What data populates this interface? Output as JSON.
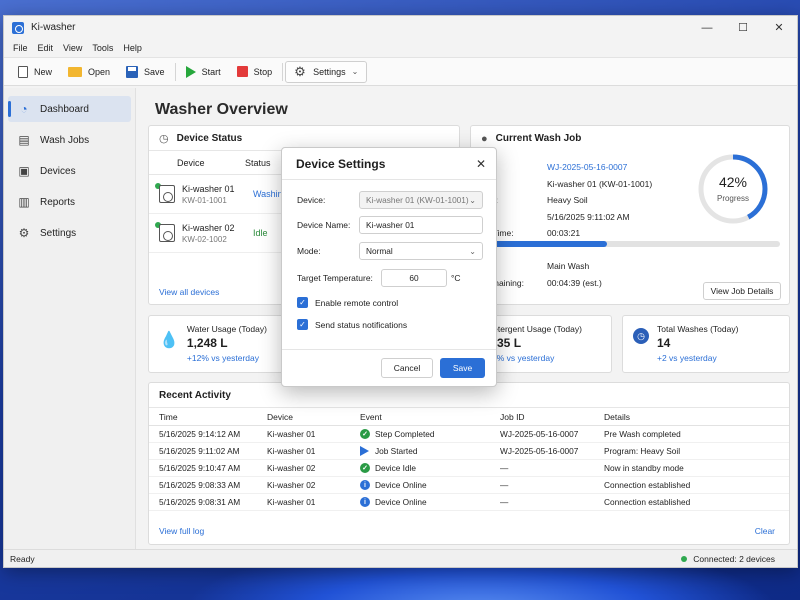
{
  "window": {
    "title": "Ki-washer",
    "minimize": "—",
    "maximize": "☐",
    "close": "✕"
  },
  "menu": [
    "File",
    "Edit",
    "View",
    "Tools",
    "Help"
  ],
  "toolbar": {
    "new": "New",
    "open": "Open",
    "save": "Save",
    "start": "Start",
    "stop": "Stop",
    "settings": "Settings"
  },
  "sidebar": {
    "items": [
      {
        "label": "Dashboard",
        "icon": "dashboard-icon",
        "active": true
      },
      {
        "label": "Wash Jobs",
        "icon": "clipboard-icon"
      },
      {
        "label": "Devices",
        "icon": "washer-icon"
      },
      {
        "label": "Reports",
        "icon": "bar-chart-icon"
      },
      {
        "label": "Settings",
        "icon": "gear-icon"
      }
    ]
  },
  "page": {
    "title": "Washer Overview"
  },
  "device_status": {
    "title": "Device Status",
    "col_device": "Device",
    "col_status": "Status",
    "devices": [
      {
        "name": "Ki-washer 01",
        "id": "KW-01-1001",
        "status": "Washing"
      },
      {
        "name": "Ki-washer 02",
        "id": "KW-02-1002",
        "status": "Idle"
      }
    ],
    "view_all": "View all devices"
  },
  "current_job": {
    "title": "Current Wash Job",
    "job_id_label": "D:",
    "job_id": "WJ-2025-05-16-0007",
    "device_label": "ce:",
    "device": "Ki-washer 01 (KW-01-1001)",
    "program_label": "ram:",
    "program": "Heavy Soil",
    "started_label": "ed:",
    "started": "5/16/2025 9:11:02 AM",
    "elapsed_label": "ed Time:",
    "elapsed": "00:03:21",
    "phase": "Main Wash",
    "remaining_label": "Remaining:",
    "remaining": "00:04:39 (est.)",
    "progress_pct": "42%",
    "progress_label": "Progress",
    "progress_value": 0.42,
    "details_button": "View Job Details"
  },
  "summary": {
    "water": {
      "label": "Water Usage (Today)",
      "value": "1,248 L",
      "delta": "+12% vs yesterday"
    },
    "detergent": {
      "label": "Detergent Usage (Today)",
      "value": "2.35 L",
      "delta": "+8% vs yesterday"
    },
    "washes": {
      "label": "Total Washes (Today)",
      "value": "14",
      "delta": "+2 vs yesterday"
    }
  },
  "activity": {
    "title": "Recent Activity",
    "headers": {
      "time": "Time",
      "device": "Device",
      "event": "Event",
      "job": "Job ID",
      "details": "Details"
    },
    "rows": [
      {
        "time": "5/16/2025 9:14:12 AM",
        "device": "Ki-washer 01",
        "event": "Step Completed",
        "icon": "check",
        "job": "WJ-2025-05-16-0007",
        "details": "Pre Wash completed"
      },
      {
        "time": "5/16/2025 9:11:02 AM",
        "device": "Ki-washer 01",
        "event": "Job Started",
        "icon": "play",
        "job": "WJ-2025-05-16-0007",
        "details": "Program: Heavy Soil"
      },
      {
        "time": "5/16/2025 9:10:47 AM",
        "device": "Ki-washer 02",
        "event": "Device Idle",
        "icon": "check",
        "job": "—",
        "details": "Now in standby mode"
      },
      {
        "time": "5/16/2025 9:08:33 AM",
        "device": "Ki-washer 02",
        "event": "Device Online",
        "icon": "info",
        "job": "—",
        "details": "Connection established"
      },
      {
        "time": "5/16/2025 9:08:31 AM",
        "device": "Ki-washer 01",
        "event": "Device Online",
        "icon": "info",
        "job": "—",
        "details": "Connection established"
      }
    ],
    "view_full": "View full log",
    "clear": "Clear"
  },
  "statusbar": {
    "left": "Ready",
    "right": "Connected: 2 devices"
  },
  "dialog": {
    "title": "Device Settings",
    "device_label": "Device:",
    "device_value": "Ki-washer 01 (KW-01-1001)",
    "name_label": "Device Name:",
    "name_value": "Ki-washer 01",
    "mode_label": "Mode:",
    "mode_value": "Normal",
    "temp_label": "Target Temperature:",
    "temp_value": "60",
    "temp_unit": "°C",
    "remote_label": "Enable remote control",
    "remote_checked": true,
    "notify_label": "Send status notifications",
    "notify_checked": true,
    "cancel": "Cancel",
    "save": "Save"
  }
}
